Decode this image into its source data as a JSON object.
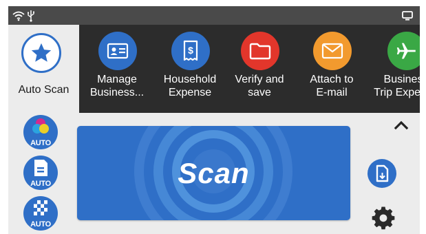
{
  "statusbar": {
    "wifi_icon": "wifi-icon",
    "usb_icon": "usb-icon",
    "display_icon": "display-icon"
  },
  "auto_scan": {
    "label": "Auto Scan",
    "icon": "star-icon"
  },
  "profiles": [
    {
      "label_line1": "Manage",
      "label_line2": "Business...",
      "icon": "business-card-icon",
      "color": "#2f6fc7"
    },
    {
      "label_line1": "Household",
      "label_line2": "Expense",
      "icon": "receipt-icon",
      "color": "#2f6fc7"
    },
    {
      "label_line1": "Verify and",
      "label_line2": "save",
      "icon": "folder-icon",
      "color": "#e2362b"
    },
    {
      "label_line1": "Attach to",
      "label_line2": "E-mail",
      "icon": "envelope-icon",
      "color": "#f29a2e"
    },
    {
      "label_line1": "Business",
      "label_line2": "Trip Expense",
      "icon": "airplane-icon",
      "color": "#3aa845"
    }
  ],
  "side_modes": [
    {
      "label": "AUTO",
      "icon": "color-mode-icon"
    },
    {
      "label": "AUTO",
      "icon": "paper-size-icon"
    },
    {
      "label": "AUTO",
      "icon": "resolution-icon"
    }
  ],
  "scan_button": {
    "label": "Scan"
  },
  "right_controls": {
    "collapse_icon": "chevron-up-icon",
    "document_icon": "document-icon",
    "settings_icon": "gear-icon"
  },
  "colors": {
    "accent_blue": "#2f6fc7",
    "profile_bar": "#2c2c2c",
    "status_bar": "#4a4a4a",
    "panel_bg": "#ececec"
  }
}
